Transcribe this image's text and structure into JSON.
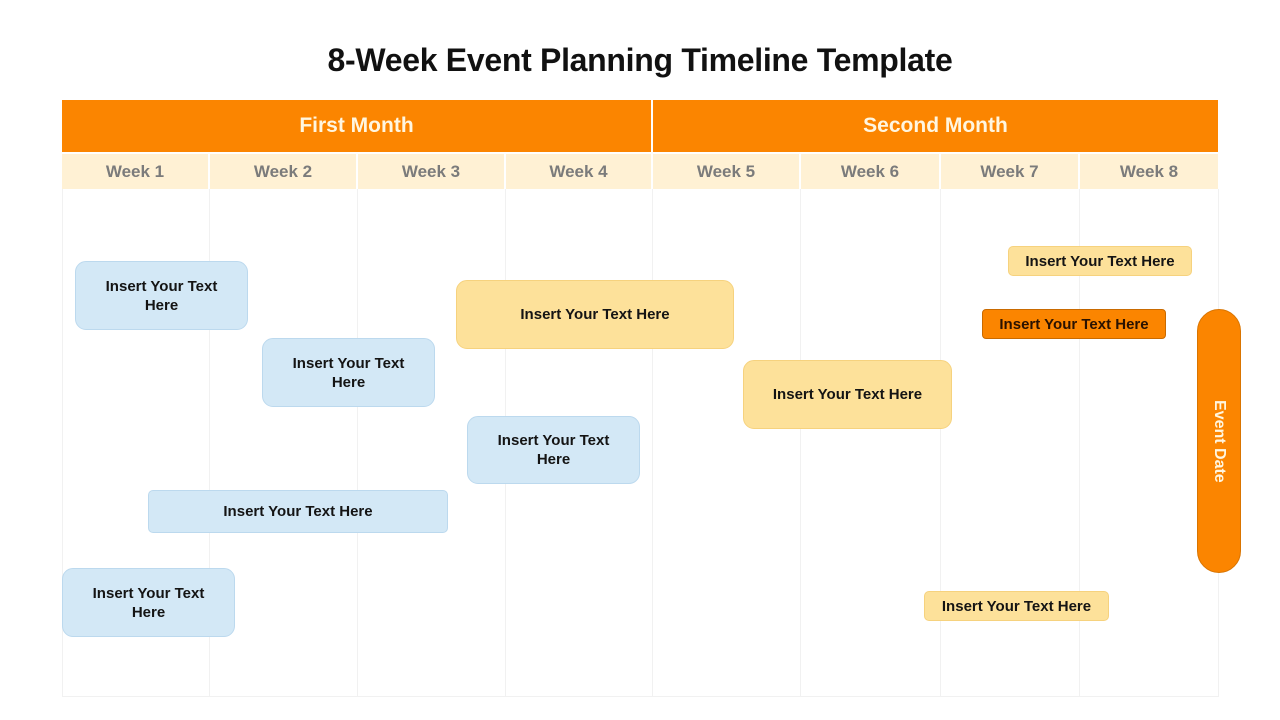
{
  "title": "8-Week Event Planning Timeline Template",
  "colors": {
    "accent_orange": "#fb8500",
    "week_header_bg": "#fff1d4",
    "task_blue": "#d3e8f6",
    "task_yellow": "#fde19a"
  },
  "months": [
    "First Month",
    "Second Month"
  ],
  "weeks": [
    "Week 1",
    "Week 2",
    "Week 3",
    "Week 4",
    "Week 5",
    "Week 6",
    "Week 7",
    "Week 8"
  ],
  "tasks": [
    {
      "text": "Insert Your Text Here",
      "color": "blue",
      "start_week": 1.1,
      "end_week": 2.3
    },
    {
      "text": "Insert Your Text Here",
      "color": "blue",
      "start_week": 2.4,
      "end_week": 3.5
    },
    {
      "text": "Insert Your Text Here",
      "color": "yellow",
      "start_week": 3.7,
      "end_week": 5.6
    },
    {
      "text": "Insert Your Text Here",
      "color": "blue",
      "start_week": 3.8,
      "end_week": 4.9
    },
    {
      "text": "Insert Your Text Here",
      "color": "blue",
      "start_week": 1.6,
      "end_week": 3.6
    },
    {
      "text": "Insert Your Text Here",
      "color": "blue",
      "start_week": 1.0,
      "end_week": 2.2
    },
    {
      "text": "Insert Your Text Here",
      "color": "yellow",
      "start_week": 5.6,
      "end_week": 7.1
    },
    {
      "text": "Insert Your Text Here",
      "color": "yellow",
      "start_week": 7.5,
      "end_week": 8.8
    },
    {
      "text": "Insert Your Text Here",
      "color": "orange",
      "start_week": 7.3,
      "end_week": 8.6
    },
    {
      "text": "Insert Your Text Here",
      "color": "yellow",
      "start_week": 6.9,
      "end_week": 8.2
    }
  ],
  "event_marker": {
    "label": "Event Date"
  }
}
